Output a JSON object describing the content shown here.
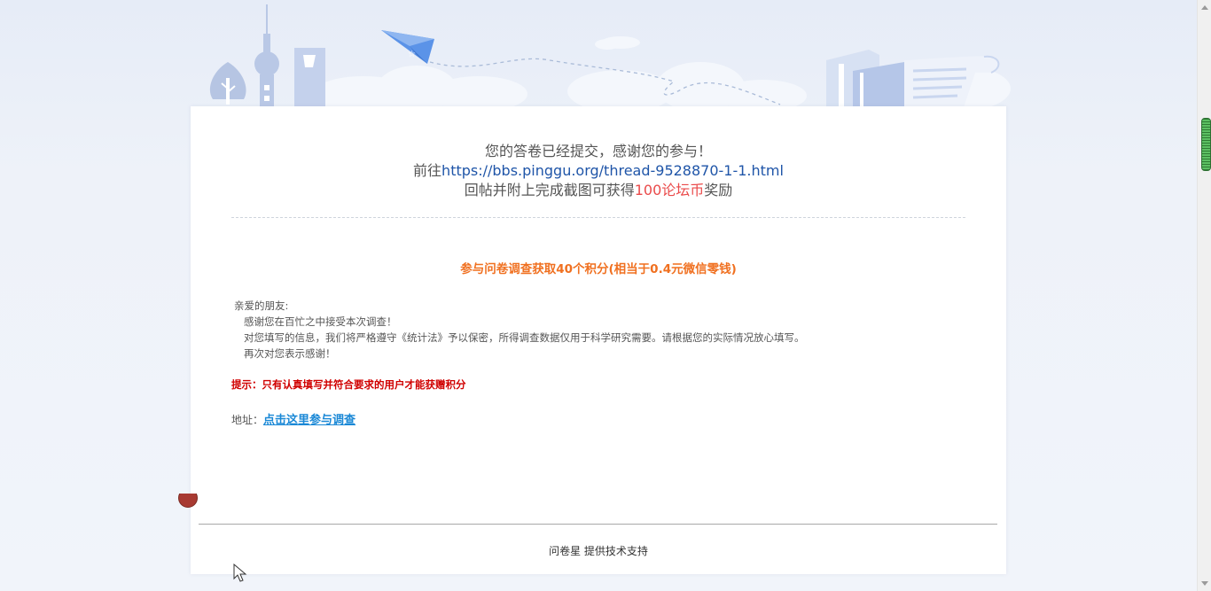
{
  "thanks": {
    "line1": "您的答卷已经提交，感谢您的参与！",
    "line2_prefix": "前往",
    "line2_link": "https://bbs.pinggu.org/thread-9528870-1-1.html",
    "line3_prefix": "回帖并附上完成截图可获得",
    "line3_highlight": "100论坛币",
    "line3_suffix": "奖励"
  },
  "survey": {
    "title": "参与问卷调查获取40个积分(相当于0.4元微信零钱)",
    "greeting": "亲爱的朋友:",
    "para1": "感谢您在百忙之中接受本次调查！",
    "para2": "对您填写的信息，我们将严格遵守《统计法》予以保密，所得调查数据仅用于科学研究需要。请根据您的实际情况放心填写。",
    "para3": "再次对您表示感谢！",
    "tip": "提示：只有认真填写并符合要求的用户才能获赠积分",
    "address_label": "地址：",
    "address_link": "点击这里参与调查"
  },
  "footer": {
    "text": "问卷星 提供技术支持"
  },
  "colors": {
    "link_blue": "#1f55a8",
    "highlight_red": "#ea4a4a",
    "title_orange": "#f07020",
    "tip_red": "#d00000",
    "survey_link": "#1a88d6",
    "scroll_thumb": "#4caf50"
  },
  "icons": [
    "paper-plane-icon",
    "tree-icon",
    "tower-icon",
    "building-icon",
    "books-icon",
    "scroll-paper-icon",
    "cursor-icon"
  ]
}
